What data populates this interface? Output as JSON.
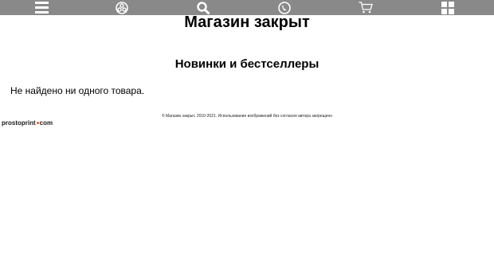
{
  "nav": {
    "icons": [
      "menu-icon",
      "categories-icon",
      "search-icon",
      "phone-icon",
      "cart-icon",
      "grid-icon"
    ],
    "bar_color": "#898989",
    "icon_color": "#ffffff"
  },
  "shop": {
    "title": "Магазин закрыт"
  },
  "section": {
    "title": "Новинки и бестселлеры",
    "empty_message": "Не найдено ни одного товара."
  },
  "footer": {
    "copyright": "© Магазин закрыт, 2010-2021. Использование изображений без согласия автора запрещено"
  },
  "brand": {
    "name_part1": "prostoprint",
    "name_part2": "com",
    "accent": "#e0562a"
  }
}
